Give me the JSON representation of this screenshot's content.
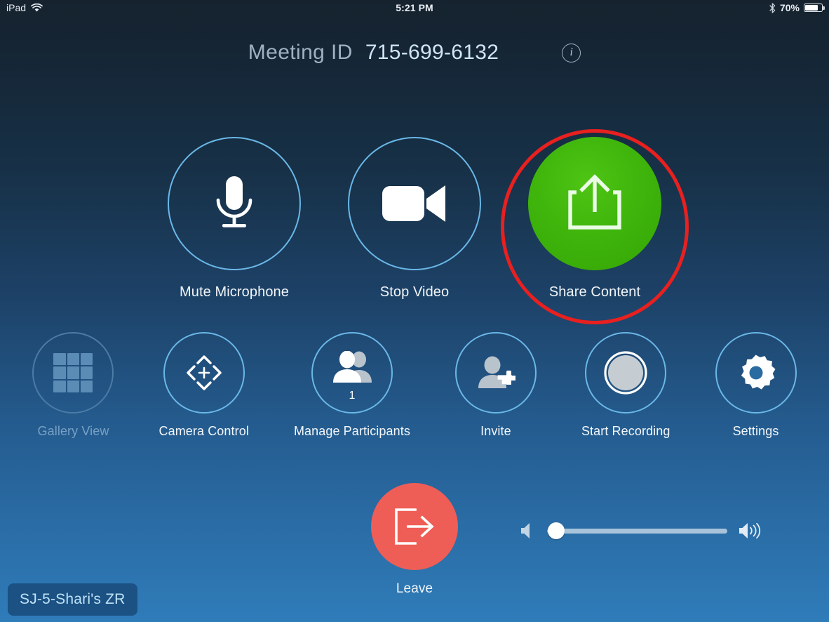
{
  "status_bar": {
    "device": "iPad",
    "wifi_icon": "wifi-icon",
    "time": "5:21 PM",
    "bluetooth_icon": "bluetooth-icon",
    "battery_percent": "70%",
    "battery_icon": "battery-icon",
    "battery_level": 70
  },
  "header": {
    "meeting_id_label": "Meeting ID",
    "meeting_id_value": "715-699-6132",
    "info_icon": "info-icon",
    "info_glyph": "i"
  },
  "primary_controls": [
    {
      "id": "mute-microphone",
      "label": "Mute Microphone",
      "icon": "microphone-icon",
      "style": "ring"
    },
    {
      "id": "stop-video",
      "label": "Stop Video",
      "icon": "video-camera-icon",
      "style": "ring"
    },
    {
      "id": "share-content",
      "label": "Share Content",
      "icon": "share-upload-icon",
      "style": "filled-green",
      "highlighted": true
    }
  ],
  "secondary_controls": [
    {
      "id": "gallery-view",
      "label": "Gallery View",
      "icon": "grid-icon",
      "disabled": true
    },
    {
      "id": "camera-control",
      "label": "Camera Control",
      "icon": "dpad-icon",
      "disabled": false
    },
    {
      "id": "manage-participants",
      "label": "Manage Participants",
      "icon": "participants-icon",
      "badge": "1",
      "disabled": false
    },
    {
      "id": "invite",
      "label": "Invite",
      "icon": "add-person-icon",
      "disabled": false
    },
    {
      "id": "start-recording",
      "label": "Start Recording",
      "icon": "record-icon",
      "disabled": false
    },
    {
      "id": "settings",
      "label": "Settings",
      "icon": "gear-icon",
      "disabled": false
    }
  ],
  "leave": {
    "label": "Leave",
    "icon": "exit-door-icon"
  },
  "volume": {
    "mute_icon": "speaker-mute-icon",
    "loud_icon": "speaker-loud-icon",
    "level": 5
  },
  "room_badge": {
    "name": "SJ-5-Shari's ZR"
  },
  "colors": {
    "accent_ring": "#6ab8e8",
    "share_green": "#3fb50c",
    "highlight_red": "#e8201f",
    "leave_red": "#ef5e56",
    "background_top": "#16232f",
    "background_bottom": "#2f7cba",
    "disabled_text": "#78a0c4"
  }
}
